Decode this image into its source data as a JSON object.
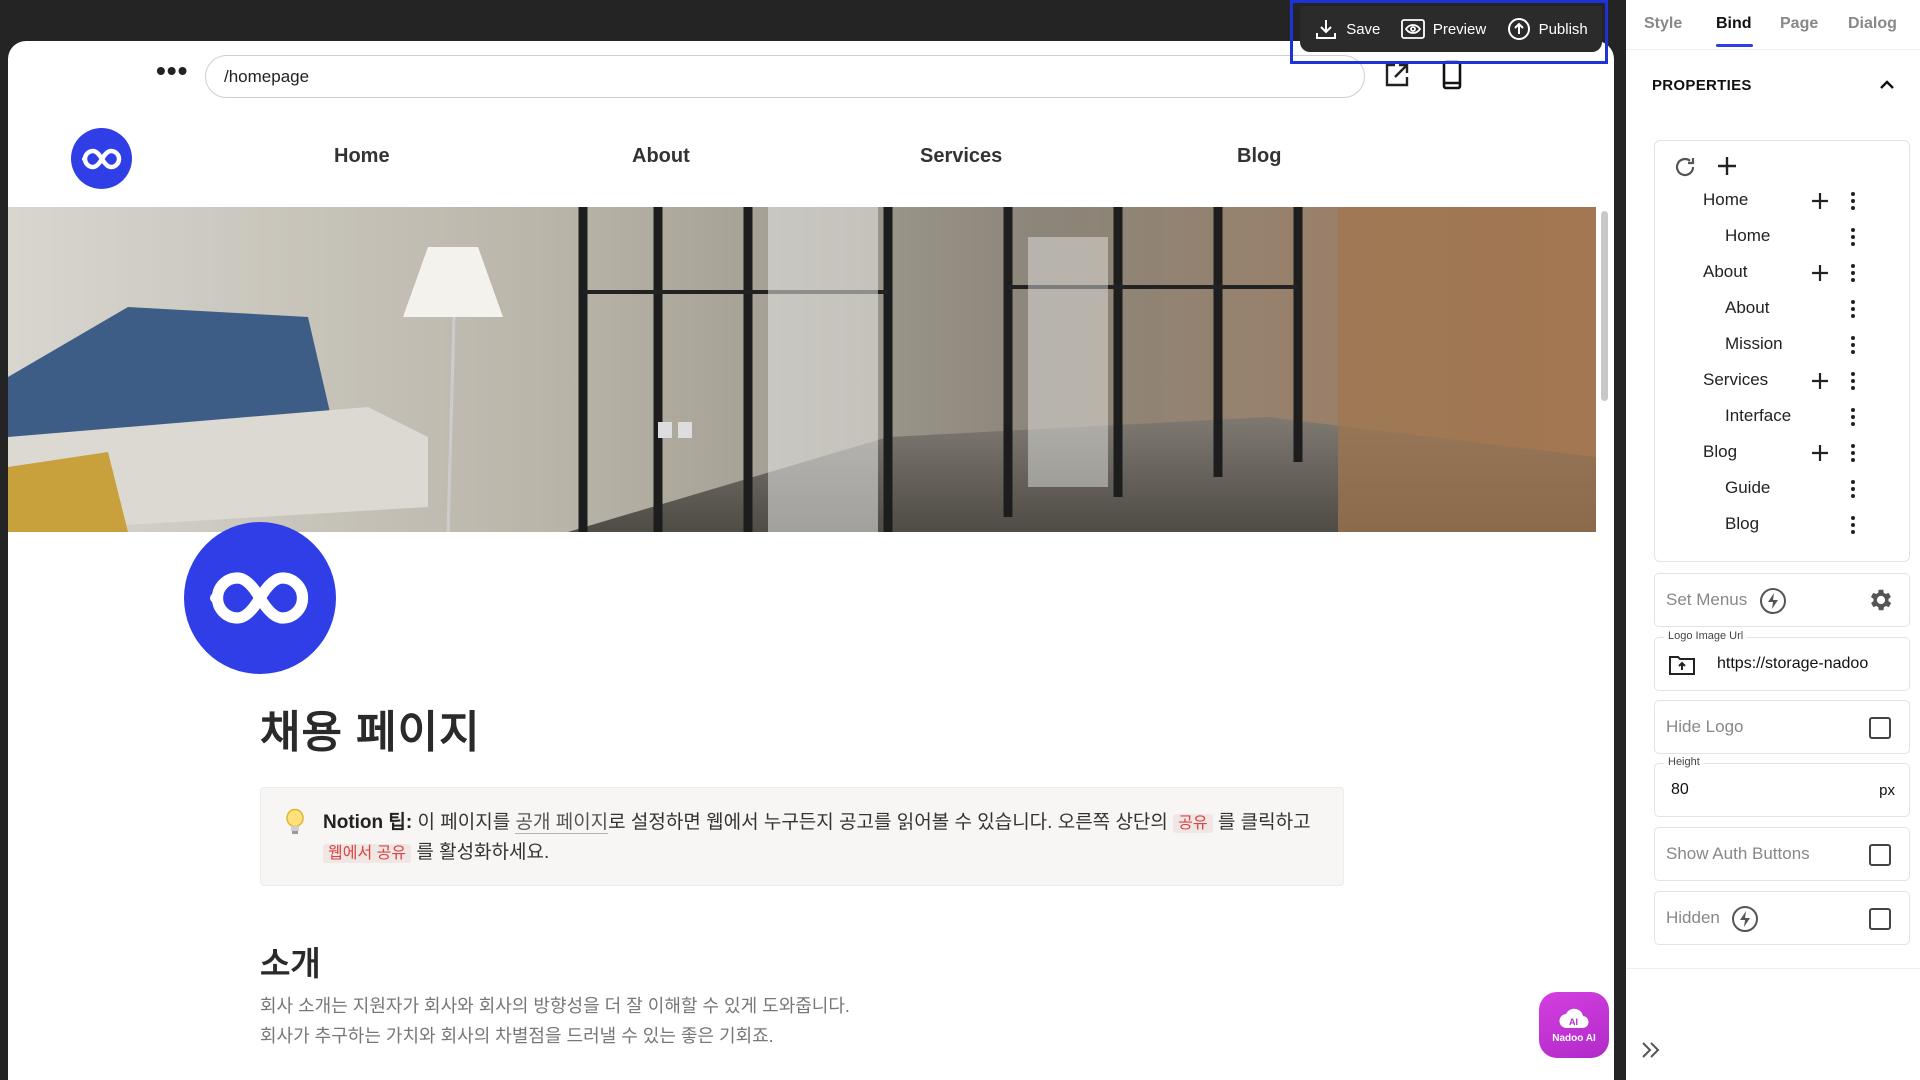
{
  "toolbar": {
    "save": "Save",
    "preview": "Preview",
    "publish": "Publish"
  },
  "url": {
    "value": "/homepage"
  },
  "site": {
    "nav": [
      "Home",
      "About",
      "Services",
      "Blog"
    ],
    "title": "채용 페이지",
    "callout": {
      "label": "Notion 팁:",
      "t1": " 이 페이지를 ",
      "link": "공개 페이지",
      "t2": "로 설정하면 웹에서 누구든지 공고를 읽어볼 수 있습니다. 오른쪽 상단의 ",
      "tag1": "공유",
      "t3": " 를 클릭하고 ",
      "tag2": "웹에서 공유",
      "t4": " 를 활성화하세요."
    },
    "section": "소개",
    "para1": "회사 소개는 지원자가 회사와 회사의 방향성을 더 잘 이해할 수 있게 도와줍니다.",
    "para2": "회사가 추구하는 가치와 회사의 차별점을 드러낼 수 있는 좋은 기회죠."
  },
  "ai_button": "Nadoo AI",
  "panel": {
    "tabs": [
      "Style",
      "Bind",
      "Page",
      "Dialog"
    ],
    "active_tab": "Bind",
    "properties": "PROPERTIES",
    "menu_tree": [
      {
        "label": "Home",
        "level": 0
      },
      {
        "label": "Home",
        "level": 1
      },
      {
        "label": "About",
        "level": 0
      },
      {
        "label": "About",
        "level": 1
      },
      {
        "label": "Mission",
        "level": 1
      },
      {
        "label": "Services",
        "level": 0
      },
      {
        "label": "Interface",
        "level": 1
      },
      {
        "label": "Blog",
        "level": 0
      },
      {
        "label": "Guide",
        "level": 1
      },
      {
        "label": "Blog",
        "level": 1
      }
    ],
    "set_menus": "Set Menus",
    "logo_url_label": "Logo Image Url",
    "logo_url_value": "https://storage-nadoo",
    "hide_logo": "Hide Logo",
    "height_label": "Height",
    "height_value": "80",
    "height_unit": "px",
    "show_auth": "Show Auth Buttons",
    "hidden": "Hidden"
  },
  "colors": {
    "brand": "#2f3ee6",
    "ai": "#c42fd6",
    "highlight_frame": "#1d33d8"
  }
}
